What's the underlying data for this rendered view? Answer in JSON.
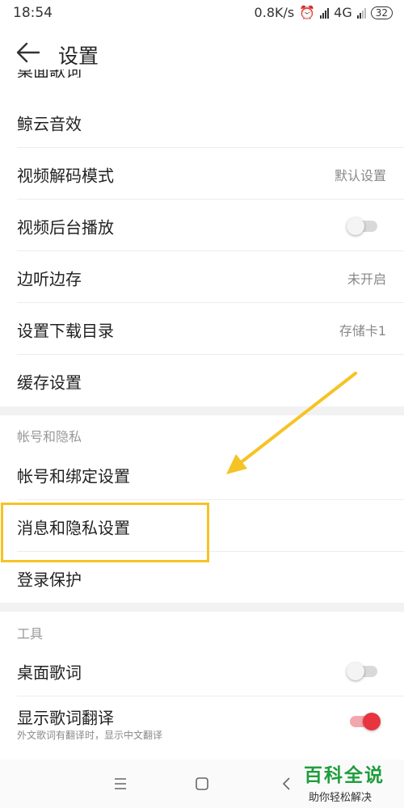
{
  "status": {
    "time": "18:54",
    "speed": "0.8K/s",
    "network": "4G",
    "battery": "32"
  },
  "header": {
    "title": "设置"
  },
  "partial_row": "桌面歌词",
  "rows_group1": [
    {
      "label": "鲸云音效",
      "value": ""
    },
    {
      "label": "视频解码模式",
      "value": "默认设置"
    },
    {
      "label": "视频后台播放",
      "toggle": "off"
    },
    {
      "label": "边听边存",
      "value": "未开启"
    },
    {
      "label": "设置下载目录",
      "value": "存储卡1"
    },
    {
      "label": "缓存设置",
      "value": ""
    }
  ],
  "section_account": {
    "title": "帐号和隐私"
  },
  "rows_account": [
    {
      "label": "帐号和绑定设置"
    },
    {
      "label": "消息和隐私设置"
    },
    {
      "label": "登录保护"
    }
  ],
  "section_tools": {
    "title": "工具"
  },
  "rows_tools": [
    {
      "label": "桌面歌词",
      "toggle": "off"
    },
    {
      "label": "显示歌词翻译",
      "sub": "外文歌词有翻译时，显示中文翻译",
      "toggle": "on"
    }
  ],
  "watermark": {
    "title": "百科全说",
    "subtitle": "助你轻松解决"
  },
  "colors": {
    "highlight": "#f6c325",
    "toggle_on": "#e8343f",
    "watermark_green": "#1f9d3c"
  }
}
